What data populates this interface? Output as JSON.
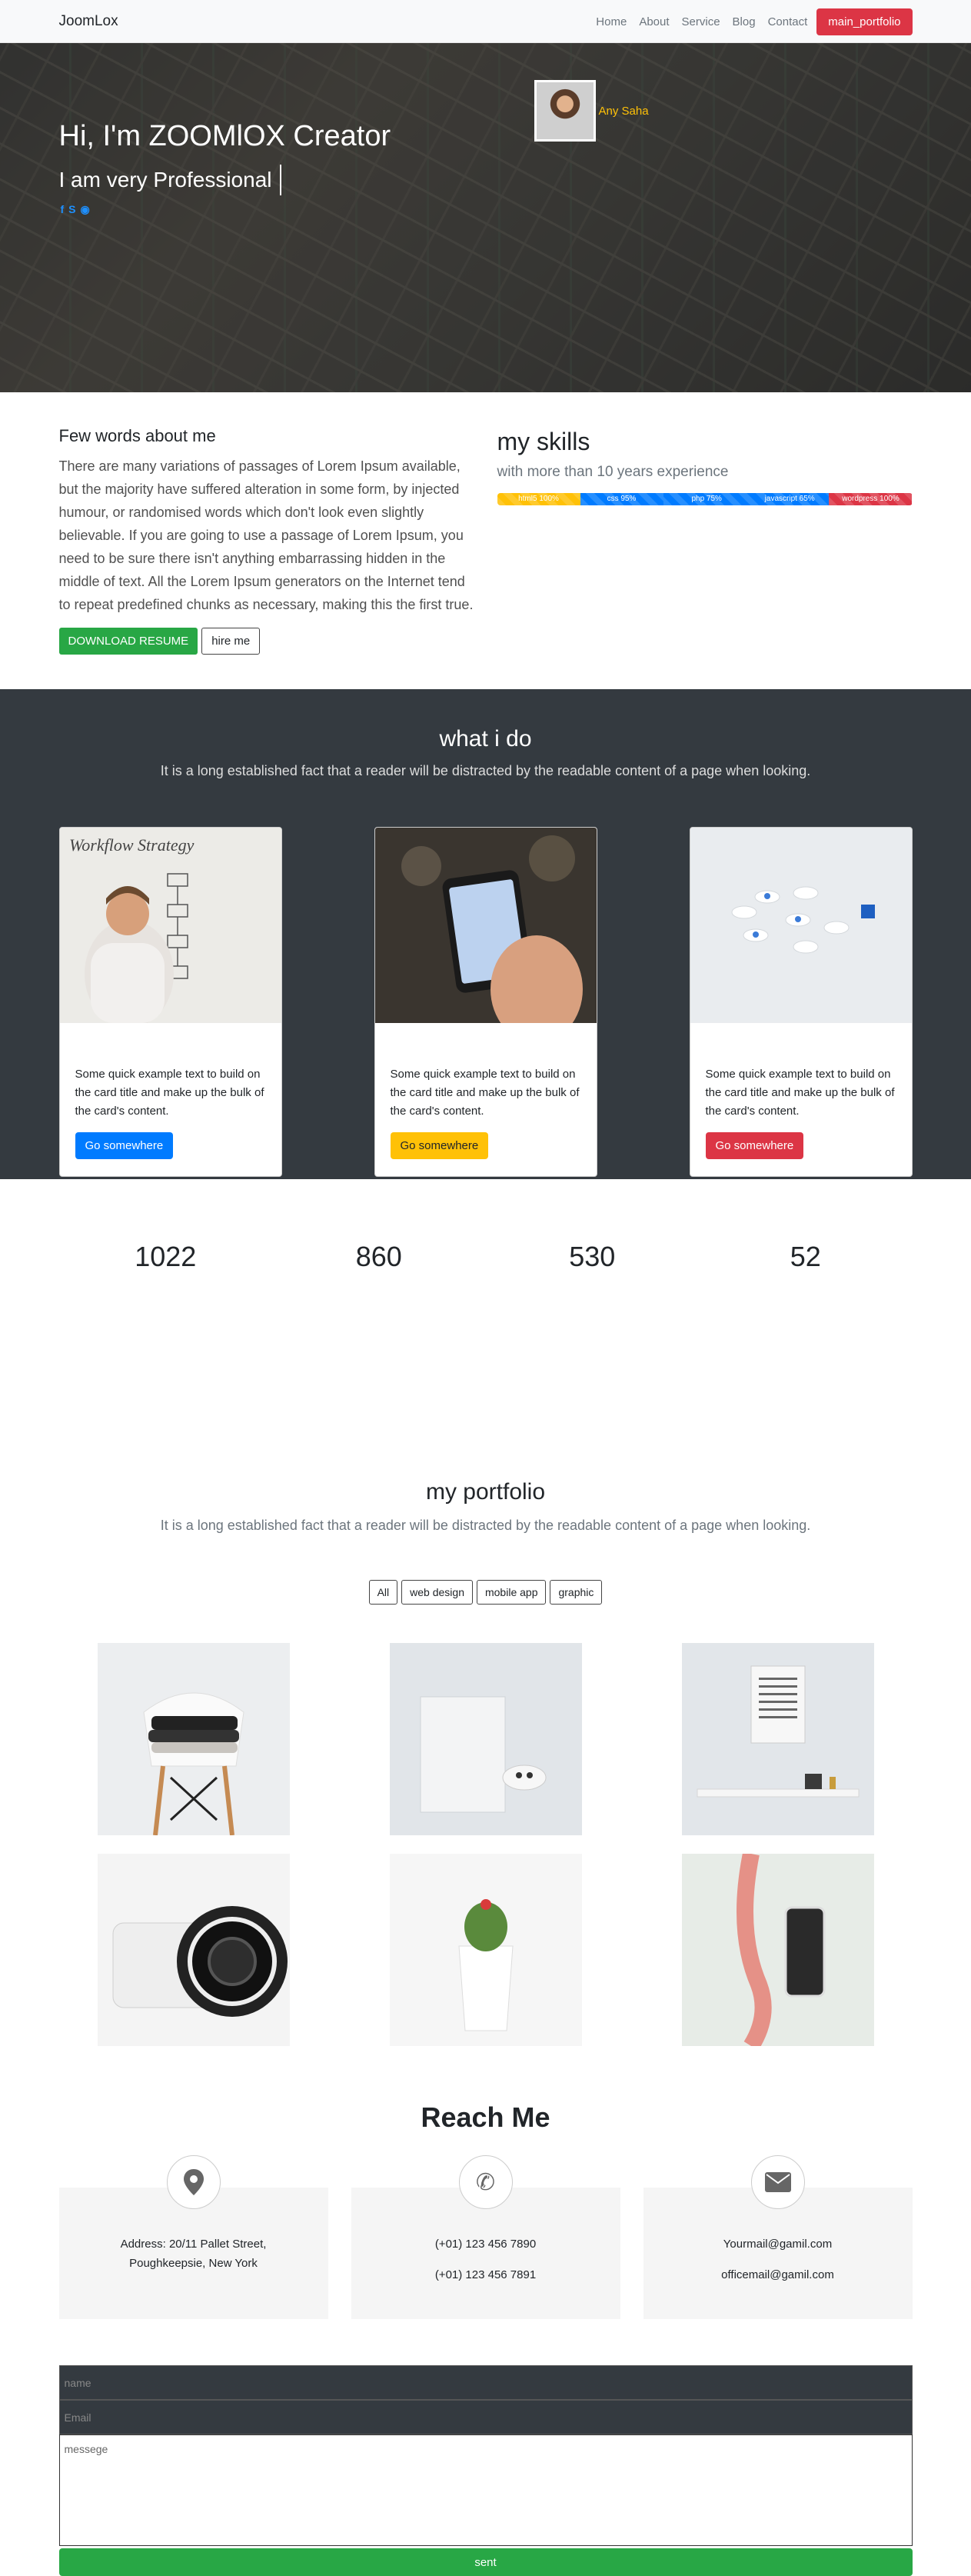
{
  "navbar": {
    "brand": "JoomLox",
    "links": [
      "Home",
      "About",
      "Service",
      "Blog",
      "Contact"
    ],
    "cta": "main_portfolio"
  },
  "hero": {
    "title": "Hi, I'm ZOOMlOX Creator",
    "subtitle": "I am very Professional",
    "profile_name": "Any Saha",
    "social_icons": [
      "facebook-icon",
      "skype-icon",
      "github-icon"
    ]
  },
  "about": {
    "heading": "Few words about me",
    "text": "There are many variations of passages of Lorem Ipsum available, but the majority have suffered alteration in some form, by injected humour, or randomised words which don't look even slightly believable. If you are going to use a passage of Lorem Ipsum, you need to be sure there isn't anything embarrassing hidden in the middle of text. All the Lorem Ipsum generators on the Internet tend to repeat predefined chunks as necessary, making this the first true.",
    "download_button": "DOWNLOAD RESUME",
    "hire_button": "hire me"
  },
  "skills": {
    "heading": "my skills",
    "experience": "with more than 10 years experience",
    "items": [
      {
        "label": "html5 100%",
        "color": "#ffc107",
        "share": 0.2
      },
      {
        "label": "css 95%",
        "color": "#007bff",
        "share": 0.2
      },
      {
        "label": "php 75%",
        "color": "#007bff",
        "share": 0.21
      },
      {
        "label": "javascript 65%",
        "color": "#007bff",
        "share": 0.19
      },
      {
        "label": "wordpress 100%",
        "color": "#dc3545",
        "share": 0.2
      }
    ]
  },
  "services": {
    "heading": "what i do",
    "lead": "It is a long established fact that a reader will be distracted by the readable content of a page when looking.",
    "cards": [
      {
        "text": "Some quick example text to build on the card title and make up the bulk of the card's content.",
        "button": "Go somewhere",
        "button_color": "#007bff",
        "button_text_color": "#ffffff"
      },
      {
        "text": "Some quick example text to build on the card title and make up the bulk of the card's content.",
        "button": "Go somewhere",
        "button_color": "#ffc107",
        "button_text_color": "#212529"
      },
      {
        "text": "Some quick example text to build on the card title and make up the bulk of the card's content.",
        "button": "Go somewhere",
        "button_color": "#dc3545",
        "button_text_color": "#ffffff"
      }
    ]
  },
  "counters": [
    "1022",
    "860",
    "530",
    "52"
  ],
  "portfolio": {
    "heading": "my portfolio",
    "lead": "It is a long established fact that a reader will be distracted by the readable content of a page when looking.",
    "filters": [
      "All",
      "web design",
      "mobile app",
      "graphic"
    ]
  },
  "reach": {
    "heading": "Reach Me",
    "address": [
      "Address: 20/11 Pallet Street,",
      "Poughkeepsie, New York"
    ],
    "phones": [
      "(+01) 123 456 7890",
      "(+01) 123 456 7891"
    ],
    "emails": [
      "Yourmail@gamil.com",
      "officemail@gamil.com"
    ]
  },
  "form": {
    "name_placeholder": "name",
    "email_placeholder": "Email",
    "message_placeholder": "messege",
    "submit": "sent"
  }
}
